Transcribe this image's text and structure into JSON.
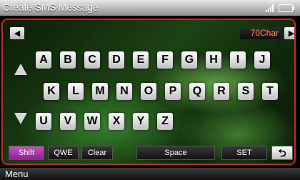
{
  "header": {
    "title": "Create SMS Message"
  },
  "char_counter": "70Char",
  "nav": {
    "left": "◀",
    "right": "▶"
  },
  "keyboard": {
    "row1": [
      "A",
      "B",
      "C",
      "D",
      "E",
      "F",
      "G",
      "H",
      "I",
      "J"
    ],
    "row2": [
      "K",
      "L",
      "M",
      "N",
      "O",
      "P",
      "Q",
      "R",
      "S",
      "T"
    ],
    "row3": [
      "U",
      "V",
      "W",
      "X",
      "Y",
      "Z"
    ]
  },
  "function_keys": {
    "shift": "Shift",
    "qwe": "QWE",
    "clear": "Clear",
    "space": "Space",
    "set": "SET",
    "back": "⮌"
  },
  "bottom": {
    "menu": "Menu"
  },
  "colors": {
    "accent_border": "#d52222",
    "counter": "#ff9a1a",
    "shift": "#b03ab0"
  }
}
